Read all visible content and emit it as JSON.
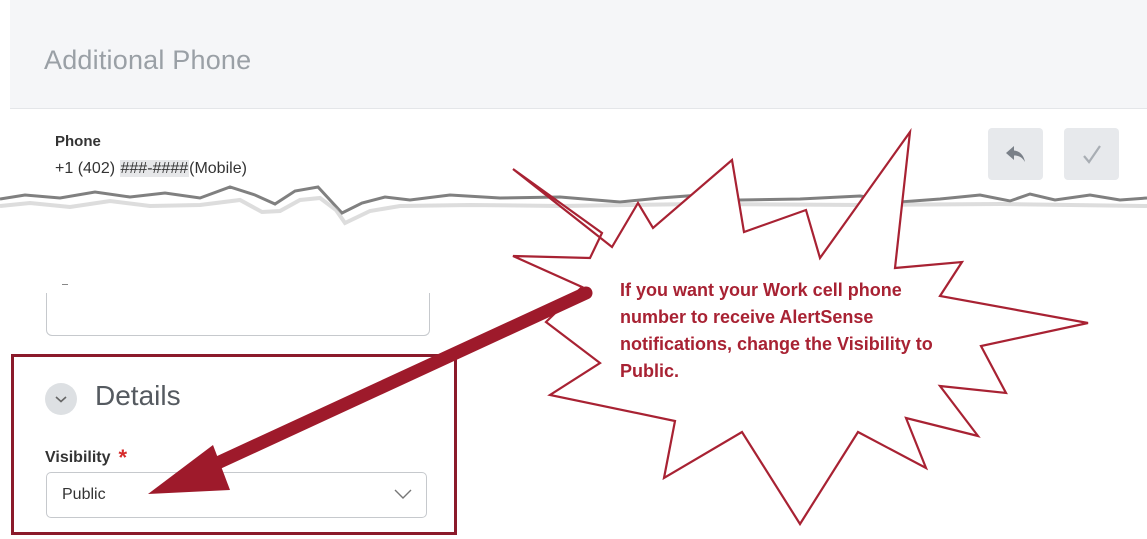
{
  "section": {
    "title": "Additional Phone"
  },
  "phone": {
    "label": "Phone",
    "value_prefix": "+1 (402)",
    "value_masked": "###-####",
    "value_suffix": "(Mobile)"
  },
  "actions": {
    "undo_icon": "undo-icon",
    "confirm_icon": "checkmark-icon"
  },
  "details": {
    "title": "Details",
    "visibility_label": "Visibility",
    "required_marker": "*",
    "visibility_value": "Public"
  },
  "callout": {
    "text": "If you want your Work cell phone number to receive AlertSense notifications, change the Visibility to Public."
  },
  "colors": {
    "annotation": "#a82233",
    "highlight_border": "#8b1a2b",
    "required": "#d62b2b"
  }
}
